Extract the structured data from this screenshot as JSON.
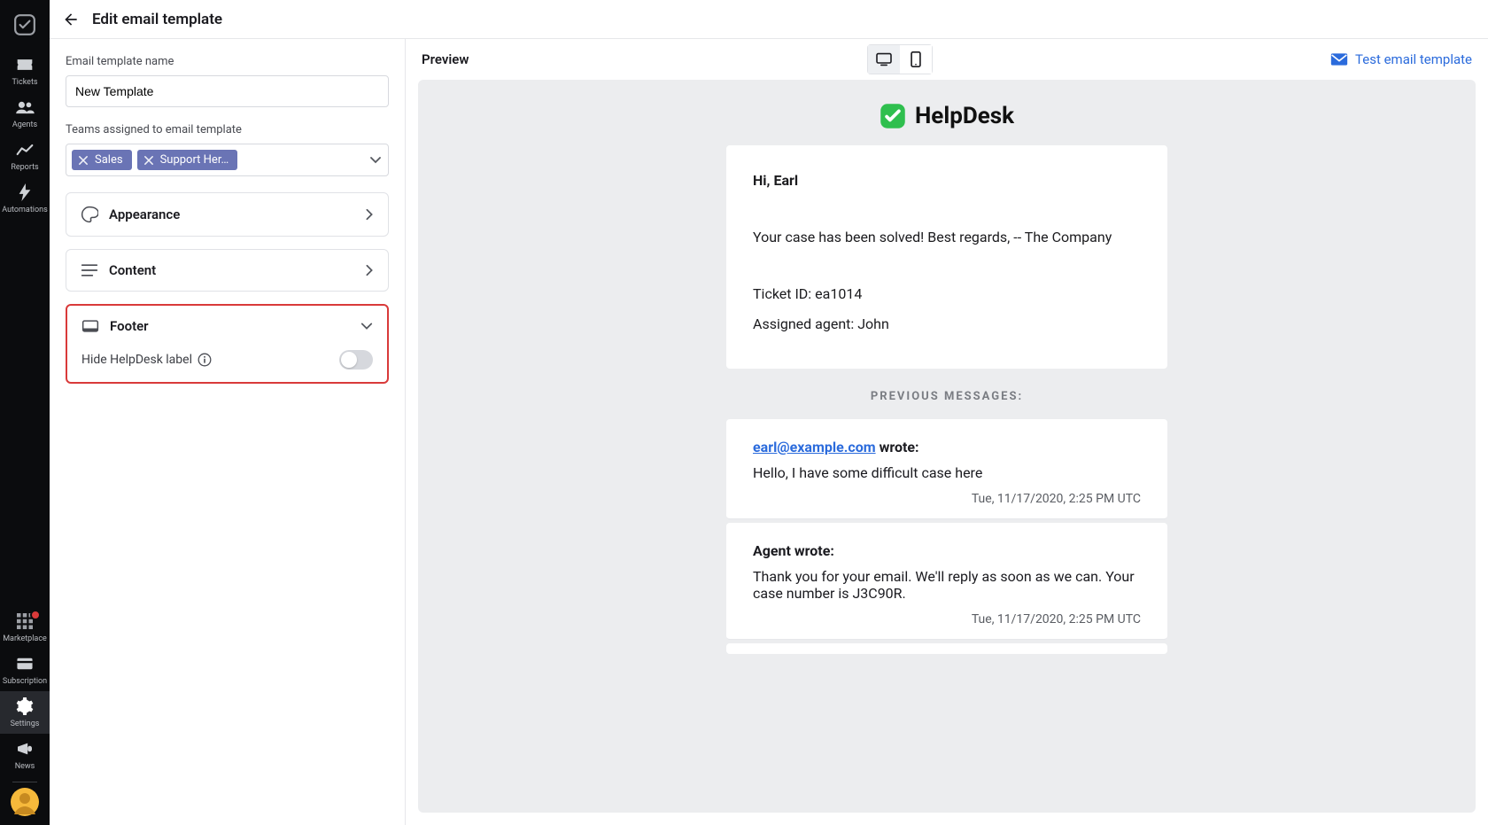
{
  "header": {
    "title": "Edit email template"
  },
  "sidebar": {
    "items": [
      {
        "label": "Tickets"
      },
      {
        "label": "Agents"
      },
      {
        "label": "Reports"
      },
      {
        "label": "Automations"
      }
    ],
    "bottom": [
      {
        "label": "Marketplace"
      },
      {
        "label": "Subscription"
      },
      {
        "label": "Settings"
      },
      {
        "label": "News"
      }
    ]
  },
  "form": {
    "name_label": "Email template name",
    "name_value": "New Template",
    "teams_label": "Teams assigned to email template",
    "team_chips": [
      "Sales",
      "Support Her…"
    ],
    "sections": {
      "appearance": "Appearance",
      "content": "Content",
      "footer": "Footer",
      "footer_option": "Hide HelpDesk label"
    }
  },
  "preview": {
    "title": "Preview",
    "test_link": "Test email template"
  },
  "brand": {
    "name": "HelpDesk"
  },
  "email": {
    "greeting": "Hi, Earl",
    "body": "Your case has been solved! Best regards, -- The Company",
    "ticket": "Ticket ID: ea1014",
    "agent": "Assigned agent: John",
    "prev_label": "PREVIOUS MESSAGES:"
  },
  "messages": [
    {
      "from": "earl@example.com",
      "wrote": " wrote:",
      "body": "Hello, I have some difficult case here",
      "ts": "Tue, 11/17/2020, 2:25 PM UTC"
    },
    {
      "header": "Agent wrote:",
      "body": "Thank you for your email. We'll reply as soon as we can. Your case number is J3C90R.",
      "ts": "Tue, 11/17/2020, 2:25 PM UTC"
    }
  ]
}
